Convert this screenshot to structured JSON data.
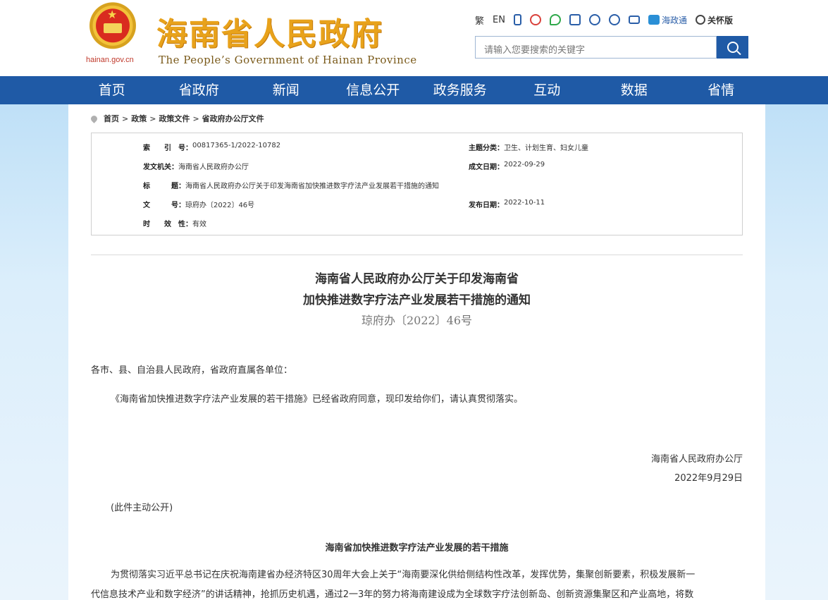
{
  "header": {
    "domain": "hainan.gov.cn",
    "title": "海南省人民政府",
    "subtitle": "The People’s Government of Hainan Province",
    "toolbar": {
      "traditional": "繁",
      "english": "EN",
      "haizhengtong": "海政通",
      "care_version": "关怀版"
    },
    "search_placeholder": "请输入您要搜索的关键字"
  },
  "nav": [
    "首页",
    "省政府",
    "新闻",
    "信息公开",
    "政务服务",
    "互动",
    "数据",
    "省情"
  ],
  "breadcrumb": [
    "首页",
    "政策",
    "政策文件",
    "省政府办公厅文件"
  ],
  "meta": {
    "index_label": "索　　引　号：",
    "index_value": "00817365-1/2022-10782",
    "topic_label": "主题分类：",
    "topic_value": "卫生、计划生育、妇女儿童",
    "issuer_label": "发文机关：",
    "issuer_value": "海南省人民政府办公厅",
    "date_label": "成文日期：",
    "date_value": "2022-09-29",
    "title_label": "标　　　题：",
    "title_value": "海南省人民政府办公厅关于印发海南省加快推进数字疗法产业发展若干措施的通知",
    "docno_label": "文　　　号：",
    "docno_value": "琼府办〔2022〕46号",
    "publish_label": "发布日期：",
    "publish_value": "2022-10-11",
    "validity_label": "时　　效　性：",
    "validity_value": "有效"
  },
  "document": {
    "title_line1": "海南省人民政府办公厅关于印发海南省",
    "title_line2": "加快推进数字疗法产业发展若干措施的通知",
    "number": "琼府办〔2022〕46号",
    "salutation": "各市、县、自治县人民政府，省政府直属各单位：",
    "body1": "《海南省加快推进数字疗法产业发展的若干措施》已经省政府同意，现印发给你们，请认真贯彻落实。",
    "signer": "海南省人民政府办公厅",
    "sign_date": "2022年9月29日",
    "public_note": "(此件主动公开)",
    "section_title": "海南省加快推进数字疗法产业发展的若干措施",
    "body2_line1": "为贯彻落实习近平总书记在庆祝海南建省办经济特区30周年大会上关于“海南要深化供给侧结构性改革，发挥优势，集聚创新要素，积极发展新一",
    "body2_line2": "代信息技术产业和数字经济”的讲话精神，抢抓历史机遇，通过2一3年的努力将海南建设成为全球数字疗法创新岛、创新资源集聚区和产业高地，将数"
  }
}
